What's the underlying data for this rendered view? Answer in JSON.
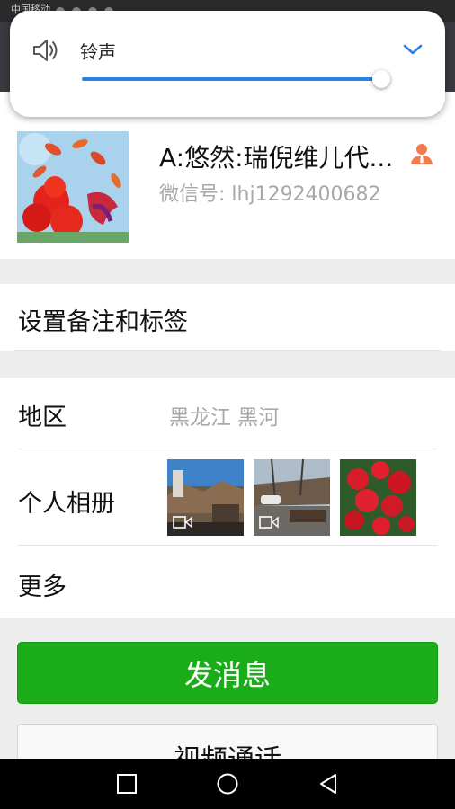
{
  "status_bar": {
    "carrier": "中国移动"
  },
  "volume_panel": {
    "label": "铃声",
    "level": 0.98
  },
  "profile": {
    "name": "A:悠然:瑞倪维儿代...",
    "wechat_id": "微信号: lhj1292400682"
  },
  "remark": {
    "label": "设置备注和标签"
  },
  "region": {
    "label": "地区",
    "value": "黑龙江  黑河"
  },
  "album": {
    "label": "个人相册"
  },
  "more": {
    "label": "更多"
  },
  "actions": {
    "send_message": "发消息",
    "video_call": "视频通话"
  },
  "colors": {
    "primary": "#1aad19",
    "slider": "#2a82e4",
    "badge": "#f37b4f"
  }
}
